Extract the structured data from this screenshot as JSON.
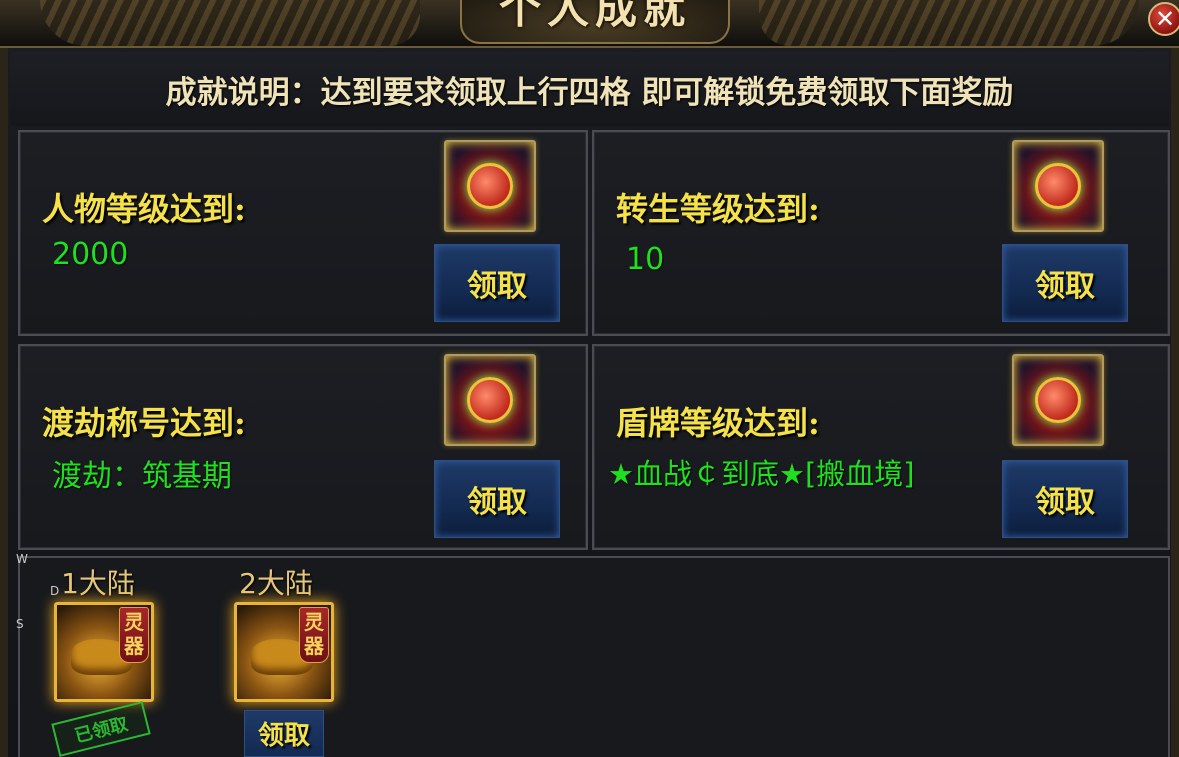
{
  "window": {
    "title": "个人成就",
    "close_icon": "✕"
  },
  "description": "成就说明：达到要求领取上行四格 即可解锁免费领取下面奖励",
  "achievements": [
    {
      "title": "人物等级达到:",
      "value": "2000",
      "button": "领取",
      "icon": "reward-bag-icon"
    },
    {
      "title": "转生等级达到:",
      "value": "10",
      "button": "领取",
      "icon": "reward-bag-icon"
    },
    {
      "title": "渡劫称号达到:",
      "value": "渡劫：筑基期",
      "button": "领取",
      "icon": "reward-bag-icon"
    },
    {
      "title": "盾牌等级达到:",
      "value": "★血战￠到底★[搬血境]",
      "button": "领取",
      "icon": "reward-bag-icon"
    }
  ],
  "continents": [
    {
      "label": "1大陆",
      "tag": "灵器",
      "status": "已领取"
    },
    {
      "label": "2大陆",
      "tag": "灵器",
      "button": "领取"
    }
  ],
  "side_keys": [
    "W",
    "D",
    "S"
  ],
  "colors": {
    "title_yellow": "#f5e24a",
    "value_green": "#1ee01e",
    "button_blue": "#132a52",
    "stamp_green": "#2ab830"
  }
}
